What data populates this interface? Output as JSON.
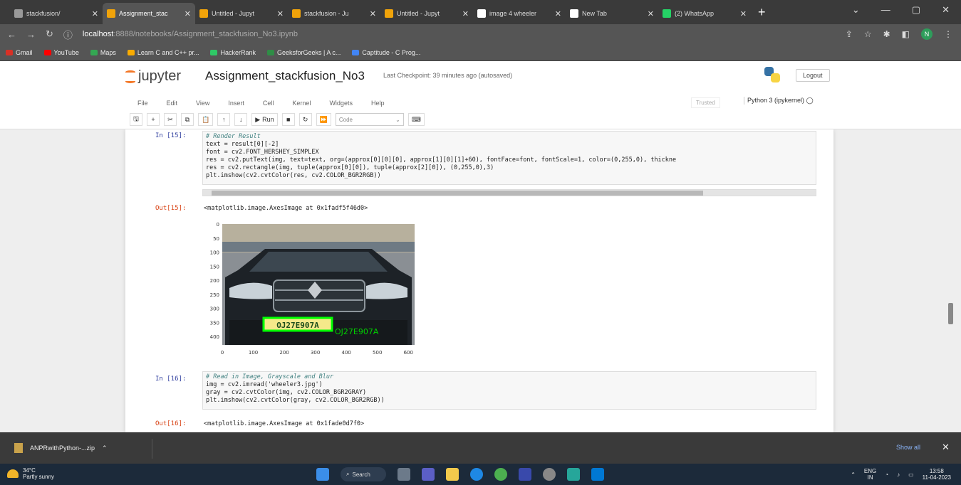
{
  "browser": {
    "tabs": [
      {
        "title": "stackfusion/",
        "color": "#999999",
        "active": false
      },
      {
        "title": "Assignment_stac",
        "color": "#f0a30a",
        "active": true
      },
      {
        "title": "Untitled - Jupyt",
        "color": "#f0a30a",
        "active": false
      },
      {
        "title": "stackfusion - Ju",
        "color": "#f0a30a",
        "active": false
      },
      {
        "title": "Untitled - Jupyt",
        "color": "#f0a30a",
        "active": false
      },
      {
        "title": "image 4 wheeler",
        "color": "#ffffff",
        "active": false
      },
      {
        "title": "New Tab",
        "color": "#ffffff",
        "active": false
      },
      {
        "title": "(2) WhatsApp",
        "color": "#25d366",
        "active": false
      }
    ],
    "new_tab": "+",
    "url_host": "localhost",
    "url_path": ":8888/notebooks/Assignment_stackfusion_No3.ipynb",
    "bookmarks": [
      {
        "label": "Gmail",
        "color": "#d93025"
      },
      {
        "label": "YouTube",
        "color": "#ff0000"
      },
      {
        "label": "Maps",
        "color": "#34a853"
      },
      {
        "label": "Learn C and C++ pr...",
        "color": "#f9ab00"
      },
      {
        "label": "HackerRank",
        "color": "#2ec866"
      },
      {
        "label": "GeeksforGeeks | A c...",
        "color": "#2f8d46"
      },
      {
        "label": "Captitude - C Prog...",
        "color": "#4285f4"
      }
    ]
  },
  "jupyter": {
    "logo_text": "jupyter",
    "notebook_name": "Assignment_stackfusion_No3",
    "checkpoint": "Last Checkpoint: 39 minutes ago  (autosaved)",
    "logout": "Logout",
    "menu": [
      "File",
      "Edit",
      "View",
      "Insert",
      "Cell",
      "Kernel",
      "Widgets",
      "Help"
    ],
    "trusted": "Trusted",
    "kernel": "Python 3 (ipykernel)",
    "run_label": "Run",
    "cell_type": "Code"
  },
  "cells": {
    "c15": {
      "prompt": "In [15]:",
      "lines": [
        "# Render Result",
        "text = result[0][-2]",
        "font = cv2.FONT_HERSHEY_SIMPLEX",
        "res = cv2.putText(img, text=text, org=(approx[0][0][0], approx[1][0][1]+60), fontFace=font, fontScale=1, color=(0,255,0), thickne",
        "res = cv2.rectangle(img, tuple(approx[0][0]), tuple(approx[2][0]), (0,255,0),3)",
        "plt.imshow(cv2.cvtColor(res, cv2.COLOR_BGR2RGB))"
      ],
      "out_prompt": "Out[15]:",
      "output": "<matplotlib.image.AxesImage at 0x1fadf5f46d0>"
    },
    "c16": {
      "prompt": "In [16]:",
      "lines": [
        "# Read in Image, Grayscale and Blur",
        "img = cv2.imread('wheeler3.jpg')",
        "gray = cv2.cvtColor(img, cv2.COLOR_BGR2GRAY)",
        "plt.imshow(cv2.cvtColor(gray, cv2.COLOR_BGR2RGB))"
      ],
      "out_prompt": "Out[16]:",
      "output": "<matplotlib.image.AxesImage at 0x1fade0d7f0>"
    }
  },
  "plot": {
    "plate_text": "OJ27E907A",
    "overlay_text": "OJ27E907A",
    "yticks": [
      "0",
      "50",
      "100",
      "150",
      "200",
      "250",
      "300",
      "350",
      "400"
    ],
    "xticks": [
      "0",
      "100",
      "200",
      "300",
      "400",
      "500",
      "600"
    ]
  },
  "downloads": {
    "file": "ANPRwithPython-...zip",
    "show_all": "Show all"
  },
  "taskbar": {
    "temp": "34°C",
    "weather": "Partly sunny",
    "search": "Search",
    "lang": "ENG",
    "region": "IN",
    "time": "13:58",
    "date": "11-04-2023"
  }
}
